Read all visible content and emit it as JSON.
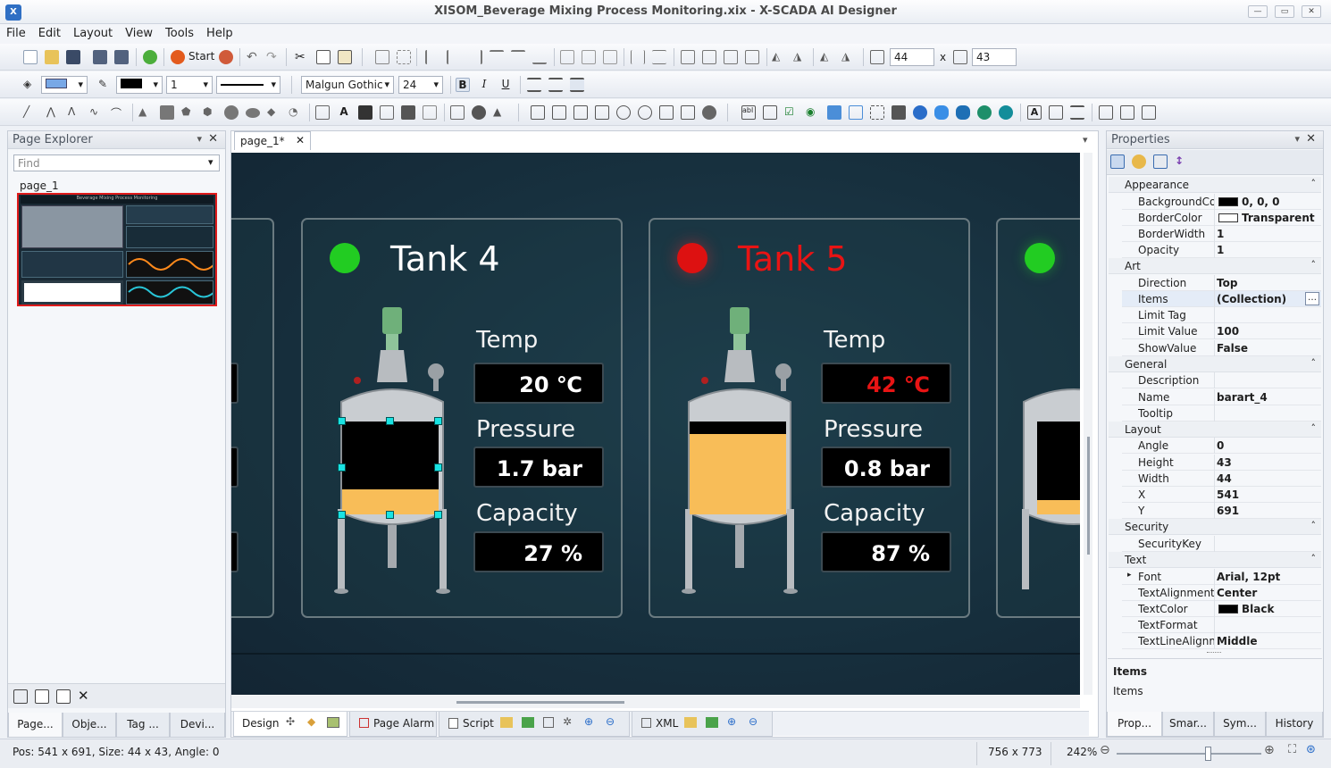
{
  "window": {
    "title": "XISOM_Beverage Mixing Process Monitoring.xix - X-SCADA AI Designer",
    "logo": "logo-icon"
  },
  "menu": [
    "File",
    "Edit",
    "Layout",
    "View",
    "Tools",
    "Help"
  ],
  "toolbar1": {
    "start_label": "Start",
    "width_value": "44",
    "times": "x",
    "height_value": "43"
  },
  "toolbar2": {
    "line_width": "1",
    "font_name": "Malgun Gothic",
    "font_size": "24",
    "bold": "B",
    "italic": "I",
    "underline": "U"
  },
  "page_explorer": {
    "title": "Page Explorer",
    "find_placeholder": "Find",
    "page_name": "page_1",
    "thumb_header": "Beverage Mixing Process Monitoring",
    "bottom_tabs": [
      "Page...",
      "Obje...",
      "Tag ...",
      "Devi..."
    ]
  },
  "doc_tab": {
    "label": "page_1*"
  },
  "canvas": {
    "tank4": {
      "title": "Tank 4",
      "temp_label": "Temp",
      "temp_value": "20 ℃",
      "pressure_label": "Pressure",
      "pressure_value": "1.7 bar",
      "capacity_label": "Capacity",
      "capacity_value": "27 %",
      "status_color": "#22cc22",
      "title_color": "#ffffff",
      "temp_color": "#ffffff",
      "fill_fraction": 0.27
    },
    "tank5": {
      "title": "Tank 5",
      "temp_label": "Temp",
      "temp_value": "42 ℃",
      "pressure_label": "Pressure",
      "pressure_value": "0.8 bar",
      "capacity_label": "Capacity",
      "capacity_value": "87 %",
      "status_color": "#dd1111",
      "title_color": "#e81414",
      "temp_color": "#e81414",
      "fill_fraction": 0.87
    },
    "tank3_partial": {
      "pressure_fragment": "ar"
    },
    "fill_color": "#f8bd58"
  },
  "design_tabs": {
    "design": "Design",
    "page_alarm": "Page Alarm",
    "script": "Script",
    "xml": "XML"
  },
  "properties": {
    "title": "Properties",
    "categories": [
      {
        "name": "Appearance",
        "rows": [
          {
            "key": "BackgroundColor",
            "value": "0, 0, 0",
            "swatch": "#000000"
          },
          {
            "key": "BorderColor",
            "value": "Transparent",
            "swatch": "#ffffff"
          },
          {
            "key": "BorderWidth",
            "value": "1"
          },
          {
            "key": "Opacity",
            "value": "1"
          }
        ]
      },
      {
        "name": "Art",
        "rows": [
          {
            "key": "Direction",
            "value": "Top"
          },
          {
            "key": "Items",
            "value": "(Collection)"
          },
          {
            "key": "Limit Tag",
            "value": ""
          },
          {
            "key": "Limit Value",
            "value": "100"
          },
          {
            "key": "ShowValue",
            "value": "False"
          }
        ]
      },
      {
        "name": "General",
        "rows": [
          {
            "key": "Description",
            "value": ""
          },
          {
            "key": "Name",
            "value": "barart_4"
          },
          {
            "key": "Tooltip",
            "value": ""
          }
        ]
      },
      {
        "name": "Layout",
        "rows": [
          {
            "key": "Angle",
            "value": "0"
          },
          {
            "key": "Height",
            "value": "43"
          },
          {
            "key": "Width",
            "value": "44"
          },
          {
            "key": "X",
            "value": "541"
          },
          {
            "key": "Y",
            "value": "691"
          }
        ]
      },
      {
        "name": "Security",
        "rows": [
          {
            "key": "SecurityKey",
            "value": ""
          }
        ]
      },
      {
        "name": "Text",
        "rows": [
          {
            "key": "Font",
            "value": "Arial, 12pt"
          },
          {
            "key": "TextAlignment",
            "value": "Center"
          },
          {
            "key": "TextColor",
            "value": "Black",
            "swatch": "#000000"
          },
          {
            "key": "TextFormat",
            "value": ""
          },
          {
            "key": "TextLineAlignment",
            "value": "Middle"
          }
        ]
      }
    ],
    "help_title": "Items",
    "help_text": "Items",
    "bottom_tabs": [
      "Prop...",
      "Smar...",
      "Sym...",
      "History"
    ]
  },
  "status": {
    "pos": "Pos: 541 x 691, Size: 44 x 43, Angle: 0",
    "canvas_size": "756 x 773",
    "zoom": "242%"
  }
}
